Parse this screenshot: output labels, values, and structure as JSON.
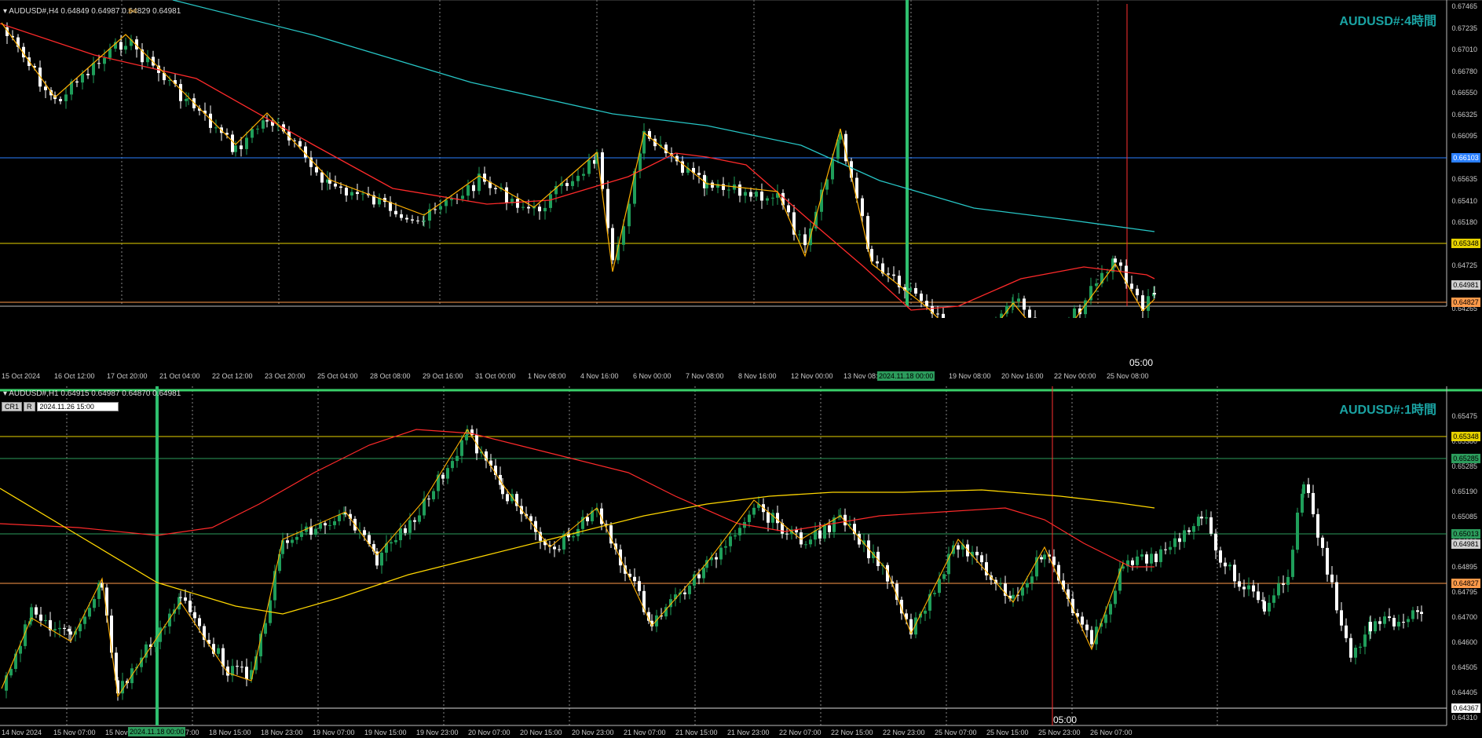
{
  "colors": {
    "background": "#000000",
    "bull_candle": "#1f9e5a",
    "bear_candle": "#ffffff",
    "ma_short": "#ff2a2a",
    "ma_long_h4": "#27c6c6",
    "ma_long_h1": "#ffd700",
    "zigzag": "#ffb000",
    "level_yellow": "#e6d200",
    "level_orange": "#ff9a4a",
    "level_blue": "#2a7fff",
    "level_green": "#2c9c5c",
    "vline_green": "#2fbf6f",
    "vline_red": "#ff3030",
    "watermark": "#1aa3a3"
  },
  "top_chart": {
    "header": "AUDUSD#,H4  0.64849 0.64987 0.64829 0.64981",
    "watermark": "AUDUSD#:4時間",
    "price_ticks": [
      "0.67465",
      "0.67235",
      "0.67010",
      "0.66780",
      "0.66550",
      "0.66325",
      "0.66095",
      "0.65865",
      "0.65635",
      "0.65410",
      "0.65180",
      "0.64950",
      "0.64725",
      "0.64495",
      "0.64265"
    ],
    "level_blue": "0.66103",
    "level_yellow": "0.65348",
    "current_price": "0.64981",
    "level_orange": "0.64827",
    "time_ticks": [
      "15 Oct 2024",
      "16 Oct 12:00",
      "17 Oct 20:00",
      "21 Oct 04:00",
      "22 Oct 12:00",
      "23 Oct 20:00",
      "25 Oct 04:00",
      "28 Oct 08:00",
      "29 Oct 16:00",
      "31 Oct 00:00",
      "1 Nov 08:00",
      "4 Nov 16:00",
      "6 Nov 00:00",
      "7 Nov 08:00",
      "8 Nov 16:00",
      "12 Nov 00:00",
      "13 Nov 08:00",
      "14 No",
      "19 Nov 08:00",
      "20 Nov 16:00",
      "22 Nov 00:00",
      "25 Nov 08:00"
    ],
    "vline_green_label": "2024.11.18 00:00",
    "vline_red_label": "05:00"
  },
  "bottom_chart": {
    "header": "AUDUSD#,H1  0.64915 0.64987 0.64870 0.64981",
    "crosshair_buttons": [
      "CR1",
      "R"
    ],
    "crosshair_datetime": "2024.11.26 15:00",
    "watermark": "AUDUSD#:1時間",
    "price_ticks": [
      "0.65475",
      "0.65380",
      "0.65285",
      "0.65190",
      "0.65085",
      "0.64990",
      "0.64895",
      "0.64795",
      "0.64700",
      "0.64600",
      "0.64505",
      "0.64405",
      "0.64310"
    ],
    "level_yellow": "0.65348",
    "level_green_upper": "0.65285",
    "level_green_lower": "0.65013",
    "current_price": "0.64981",
    "level_orange": "0.64827",
    "level_gray": "0.64367",
    "time_ticks": [
      "14 Nov 2024",
      "15 Nov 07:00",
      "15 Nov",
      "18 Nov 07:00",
      "18 Nov 15:00",
      "18 Nov 23:00",
      "19 Nov 07:00",
      "19 Nov 15:00",
      "19 Nov 23:00",
      "20 Nov 07:00",
      "20 Nov 15:00",
      "20 Nov 23:00",
      "21 Nov 07:00",
      "21 Nov 15:00",
      "21 Nov 23:00",
      "22 Nov 07:00",
      "22 Nov 15:00",
      "22 Nov 23:00",
      "25 Nov 07:00",
      "25 Nov 15:00",
      "25 Nov 23:00",
      "26 Nov 07:00"
    ],
    "vline_green_label": "2024.11.18 00:00",
    "vline_red_label": "05:00"
  }
}
